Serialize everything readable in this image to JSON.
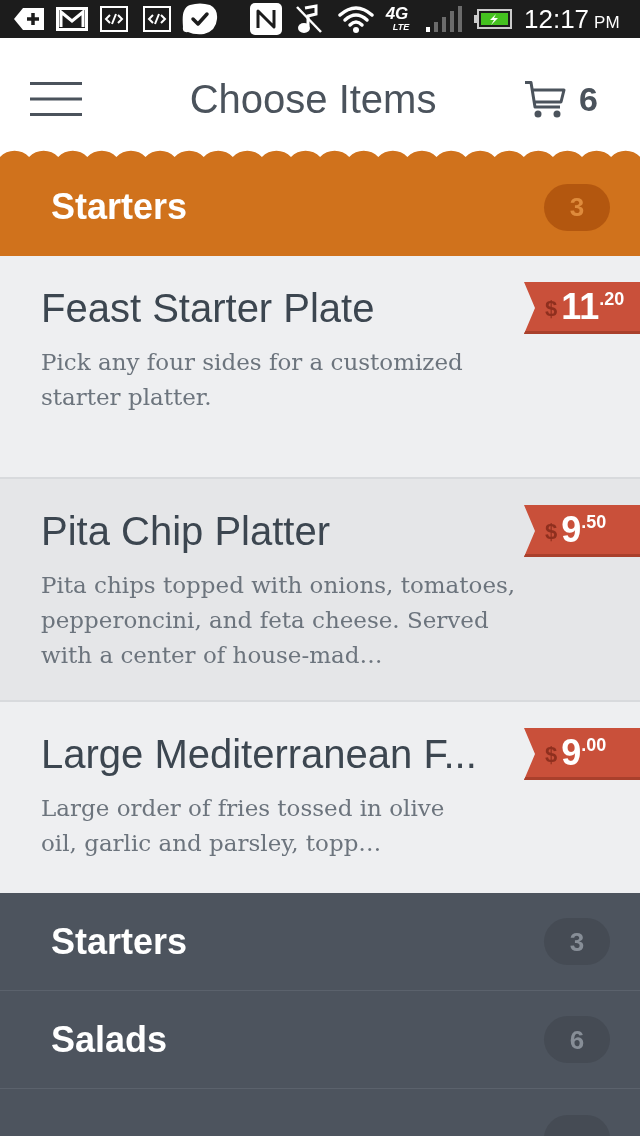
{
  "status_bar": {
    "network": "4G",
    "network_sub": "LTE",
    "time": "12:17",
    "meridiem": "PM"
  },
  "header": {
    "title": "Choose Items",
    "cart_count": "6"
  },
  "menu": {
    "open_category": {
      "name": "Starters",
      "count": "3",
      "expanded": true,
      "items": [
        {
          "name": "Feast Starter Plate",
          "description_lines": [
            "Pick any four sides for a customized",
            "starter platter."
          ],
          "price": {
            "currency": "$",
            "whole": "11",
            "cents": ".20"
          },
          "selected": false
        },
        {
          "name": "Pita Chip Platter",
          "description_lines": [
            "Pita chips topped with onions, tomatoes,",
            "pepperoncini, and feta cheese. Served",
            "with a center of house-mad…"
          ],
          "price": {
            "currency": "$",
            "whole": "9",
            "cents": ".50"
          },
          "selected": true
        },
        {
          "name": "Large Mediterranean F...",
          "description_lines": [
            "Large order of fries tossed in olive",
            "oil, garlic and parsley, topp…"
          ],
          "price": {
            "currency": "$",
            "whole": "9",
            "cents": ".00"
          },
          "selected": false
        }
      ]
    },
    "categories": [
      {
        "kind": "row",
        "name": "Starters",
        "count": "3"
      },
      {
        "kind": "row",
        "name": "Salads",
        "count": "6"
      },
      {
        "kind": "cut_off"
      }
    ]
  }
}
